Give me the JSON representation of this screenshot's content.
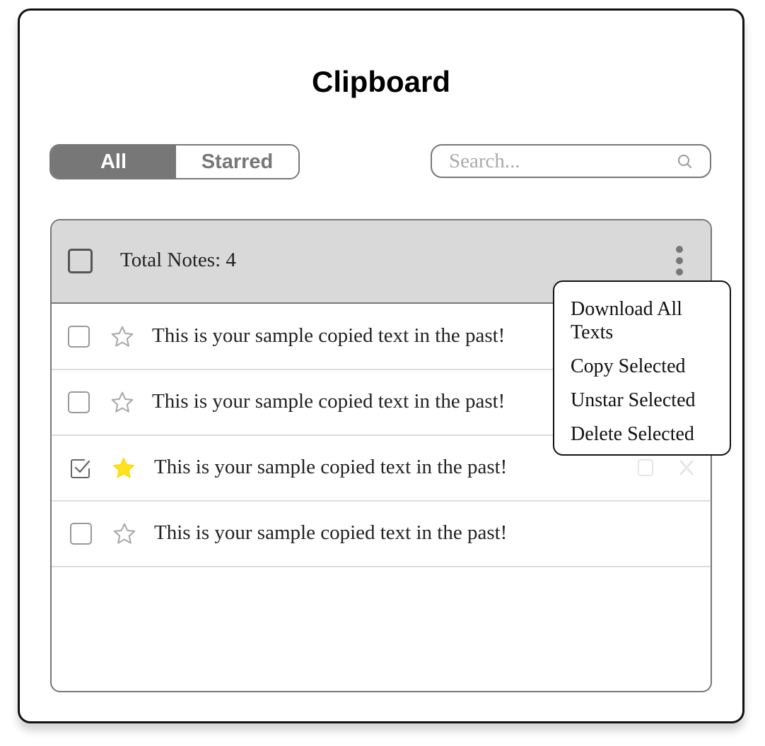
{
  "app": {
    "title": "Clipboard"
  },
  "tabs": [
    {
      "label": "All",
      "active": true
    },
    {
      "label": "Starred",
      "active": false
    }
  ],
  "search": {
    "placeholder": "Search...",
    "value": "",
    "icon": "search-icon"
  },
  "list_header": {
    "total_label": "Total Notes: 4",
    "more_icon": "kebab-menu-icon"
  },
  "notes": [
    {
      "text": "This is your sample copied text in the past!",
      "checked": false,
      "starred": false
    },
    {
      "text": "This is your sample copied text in the past!",
      "checked": false,
      "starred": false
    },
    {
      "text": "This is your sample copied text in the past!",
      "checked": true,
      "starred": true
    },
    {
      "text": "This is your sample copied text in the past!",
      "checked": false,
      "starred": false
    }
  ],
  "menu": {
    "items": [
      {
        "label": "Download All Texts"
      },
      {
        "label": "Copy Selected"
      },
      {
        "label": "Unstar Selected"
      },
      {
        "label": "Delete Selected"
      }
    ]
  },
  "colors": {
    "accent_gray": "#777777",
    "header_bg": "#d9d9d9",
    "star_active": "#ffe11f",
    "star_inactive": "#aaaaaa"
  }
}
